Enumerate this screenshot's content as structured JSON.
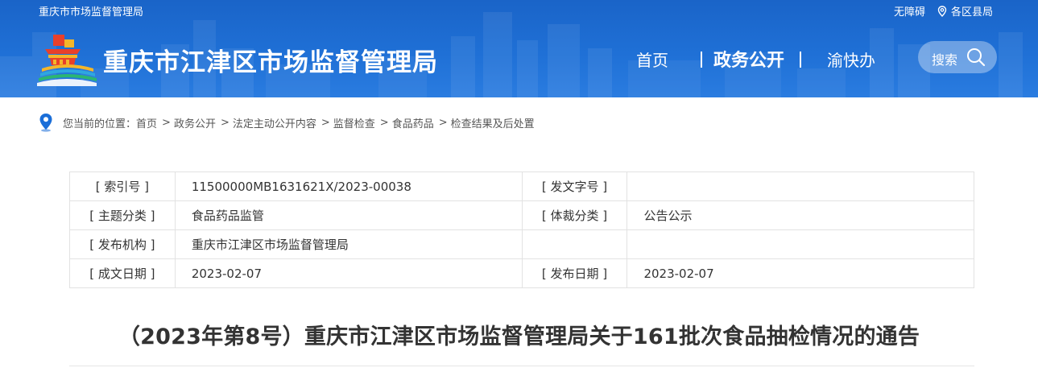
{
  "header": {
    "top_left_text": "重庆市市场监督管理局",
    "accessibility_link": "无障碍",
    "districts_link": "各区县局",
    "site_title": "重庆市江津区市场监督管理局",
    "nav": {
      "home": "首页",
      "gov_affairs": "政务公开",
      "yukuaiban": "渝快办"
    },
    "search_label": "搜索",
    "colors": {
      "header_blue": "#1f70d6"
    }
  },
  "breadcrumb": {
    "prefix": "您当前的位置：",
    "items": [
      "首页",
      "政务公开",
      "法定主动公开内容",
      "监督检查",
      "食品药品",
      "检查结果及后处置"
    ],
    "separator": ">"
  },
  "info_table": {
    "rows": [
      {
        "label1": "[ 索引号 ]",
        "value1": "11500000MB1631621X/2023-00038",
        "label2": "[ 发文字号 ]",
        "value2": ""
      },
      {
        "label1": "[ 主题分类 ]",
        "value1": "食品药品监管",
        "label2": "[ 体裁分类 ]",
        "value2": "公告公示"
      },
      {
        "label1": "[ 发布机构 ]",
        "value1": "重庆市江津区市场监督管理局",
        "label2": "",
        "value2": ""
      },
      {
        "label1": "[ 成文日期 ]",
        "value1": "2023-02-07",
        "label2": "[ 发布日期 ]",
        "value2": "2023-02-07"
      }
    ]
  },
  "article": {
    "title": "（2023年第8号）重庆市江津区市场监督管理局关于161批次食品抽检情况的通告"
  }
}
